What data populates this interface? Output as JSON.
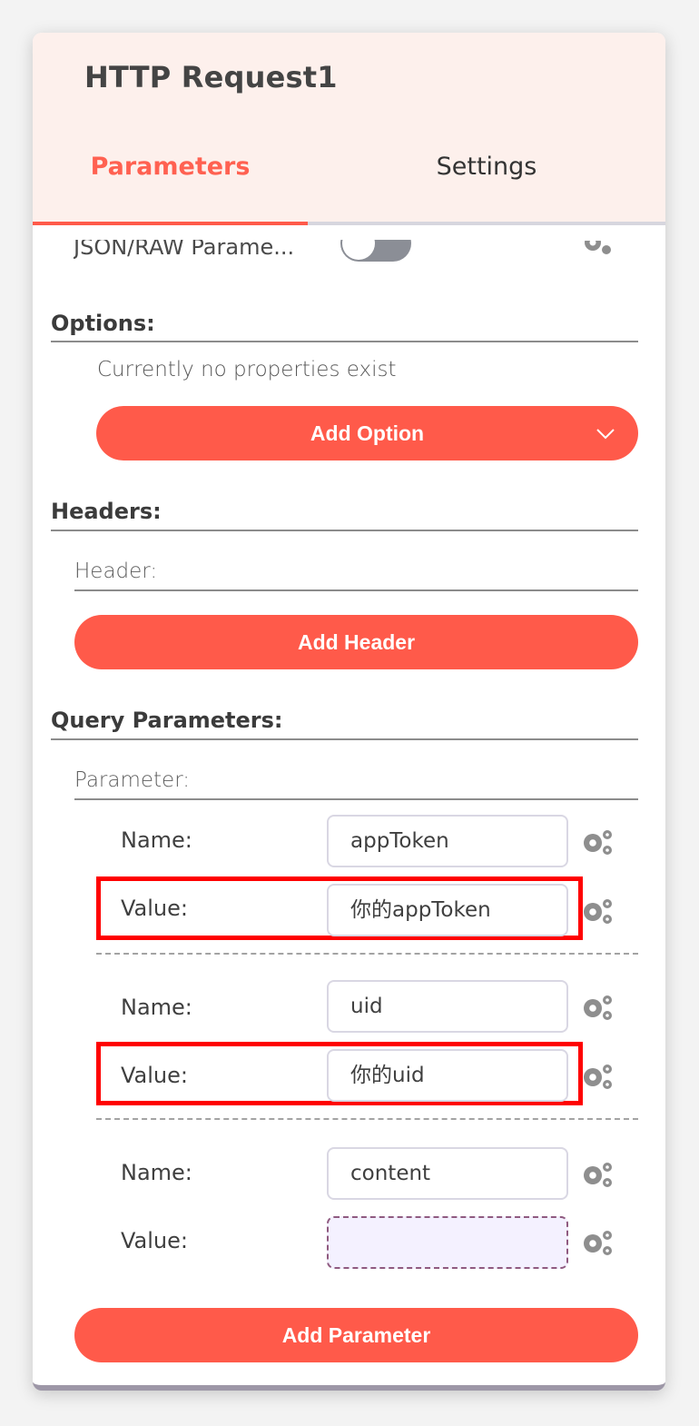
{
  "panel": {
    "title": "HTTP Request1",
    "tabs": [
      {
        "label": "Parameters",
        "active": true
      },
      {
        "label": "Settings",
        "active": false
      }
    ]
  },
  "cutoff_row": {
    "label": "JSON/RAW Parame...",
    "toggle_on": false
  },
  "options": {
    "label": "Options:",
    "empty_message": "Currently no properties exist",
    "add_button": "Add Option"
  },
  "headers": {
    "label": "Headers:",
    "sub_label": "Header:",
    "add_button": "Add Header"
  },
  "query": {
    "label": "Query Parameters:",
    "sub_label": "Parameter:",
    "name_label": "Name:",
    "value_label": "Value:",
    "params": [
      {
        "name": "appToken",
        "value": "你的appToken"
      },
      {
        "name": "uid",
        "value": "你的uid"
      },
      {
        "name": "content",
        "value": ""
      }
    ],
    "add_button": "Add Parameter"
  },
  "colors": {
    "accent": "#ff5a4a",
    "header_bg": "#fdf0ec",
    "highlight": "#ff0000",
    "toggle_off": "#8b8e96"
  },
  "icons": {
    "gear": "gears-icon",
    "chevron": "chevron-down-icon"
  }
}
